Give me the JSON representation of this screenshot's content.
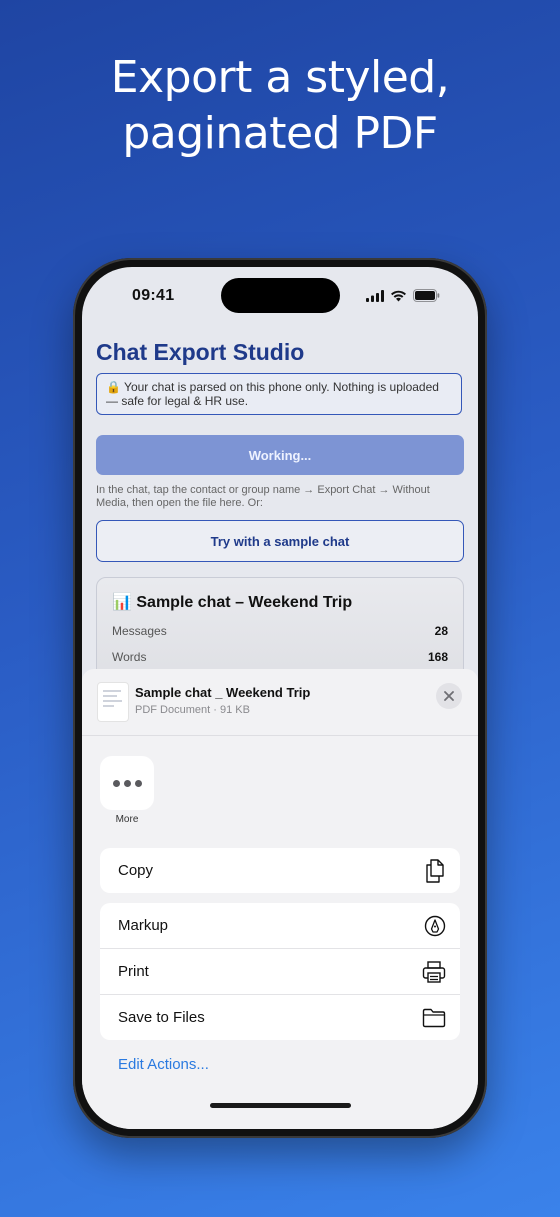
{
  "headline": {
    "line1": "Export a styled,",
    "line2": "paginated PDF"
  },
  "status_bar": {
    "time": "09:41",
    "icons": [
      "signal-icon",
      "wifi-icon",
      "battery-icon"
    ]
  },
  "app": {
    "title": "Chat Export Studio",
    "privacy_note": "🔒 Your chat is parsed on this phone only. Nothing is uploaded — safe for legal & HR use.",
    "working_button": "Working...",
    "hint": "In the chat, tap the contact or group name → Export Chat → Without Media, then open the file here. Or:",
    "sample_button": "Try with a sample chat",
    "stats": {
      "title": "📊 Sample chat – Weekend Trip",
      "rows": [
        {
          "label": "Messages",
          "value": "28"
        },
        {
          "label": "Words",
          "value": "168"
        }
      ]
    }
  },
  "share_sheet": {
    "file_name": "Sample chat _ Weekend Trip",
    "file_meta": "PDF Document · 91 KB",
    "more_label": "More",
    "group1": [
      {
        "label": "Copy",
        "icon": "copy-icon"
      }
    ],
    "group2": [
      {
        "label": "Markup",
        "icon": "markup-icon"
      },
      {
        "label": "Print",
        "icon": "printer-icon"
      },
      {
        "label": "Save to Files",
        "icon": "folder-icon"
      }
    ],
    "edit_actions": "Edit Actions..."
  },
  "colors": {
    "accent": "#1f3a8a",
    "link": "#2a7ae0",
    "background_top": "#1f45a3",
    "background_bottom": "#3a82ea"
  }
}
